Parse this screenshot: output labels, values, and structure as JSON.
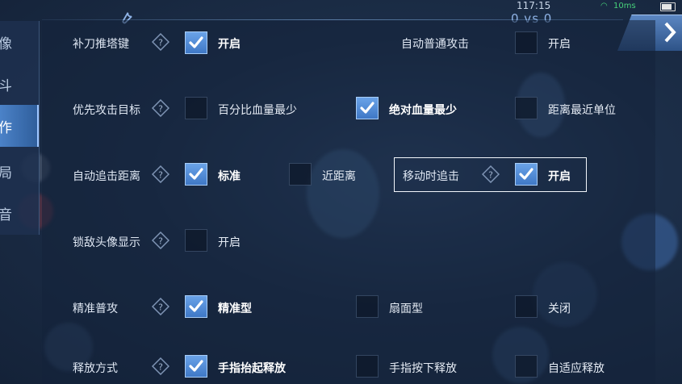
{
  "status_bar": {
    "clock": "117:15",
    "vs": "0 vs 0",
    "ping": "10ms"
  },
  "sidebar": {
    "items": [
      {
        "label": "像",
        "active": false
      },
      {
        "label": "斗",
        "active": false
      },
      {
        "label": "作",
        "active": true
      },
      {
        "label": "局",
        "active": false
      },
      {
        "label": "音",
        "active": false
      }
    ]
  },
  "settings": {
    "last_hit_tower": {
      "label": "补刀推塔键",
      "option_on": "开启",
      "checked": true
    },
    "auto_attack": {
      "label": "自动普通攻击",
      "option_on": "开启",
      "checked": false
    },
    "priority_target": {
      "label": "优先攻击目标",
      "options": [
        {
          "text": "百分比血量最少",
          "checked": false
        },
        {
          "text": "绝对血量最少",
          "checked": true
        },
        {
          "text": "距离最近单位",
          "checked": false
        }
      ]
    },
    "auto_chase_distance": {
      "label": "自动追击距离",
      "options": [
        {
          "text": "标准",
          "checked": true
        },
        {
          "text": "近距离",
          "checked": false
        }
      ]
    },
    "chase_while_moving": {
      "label": "移动时追击",
      "option_on": "开启",
      "checked": true
    },
    "lock_enemy_avatar": {
      "label": "锁敌头像显示",
      "option_on": "开启",
      "checked": false
    },
    "precise_attack": {
      "label": "精准普攻",
      "options": [
        {
          "text": "精准型",
          "checked": true
        },
        {
          "text": "扇面型",
          "checked": false
        },
        {
          "text": "关闭",
          "checked": false
        }
      ]
    },
    "release_mode": {
      "label": "释放方式",
      "options": [
        {
          "text": "手指抬起释放",
          "checked": true
        },
        {
          "text": "手指按下释放",
          "checked": false
        },
        {
          "text": "自适应释放",
          "checked": false
        }
      ]
    }
  },
  "colors": {
    "accent": "#4f8ad6",
    "check": "#ffffff",
    "ping": "#46d17a"
  },
  "icons": [
    "wrench-icon",
    "close-icon",
    "help-icon",
    "checkmark-icon",
    "wifi-icon",
    "battery-icon"
  ]
}
